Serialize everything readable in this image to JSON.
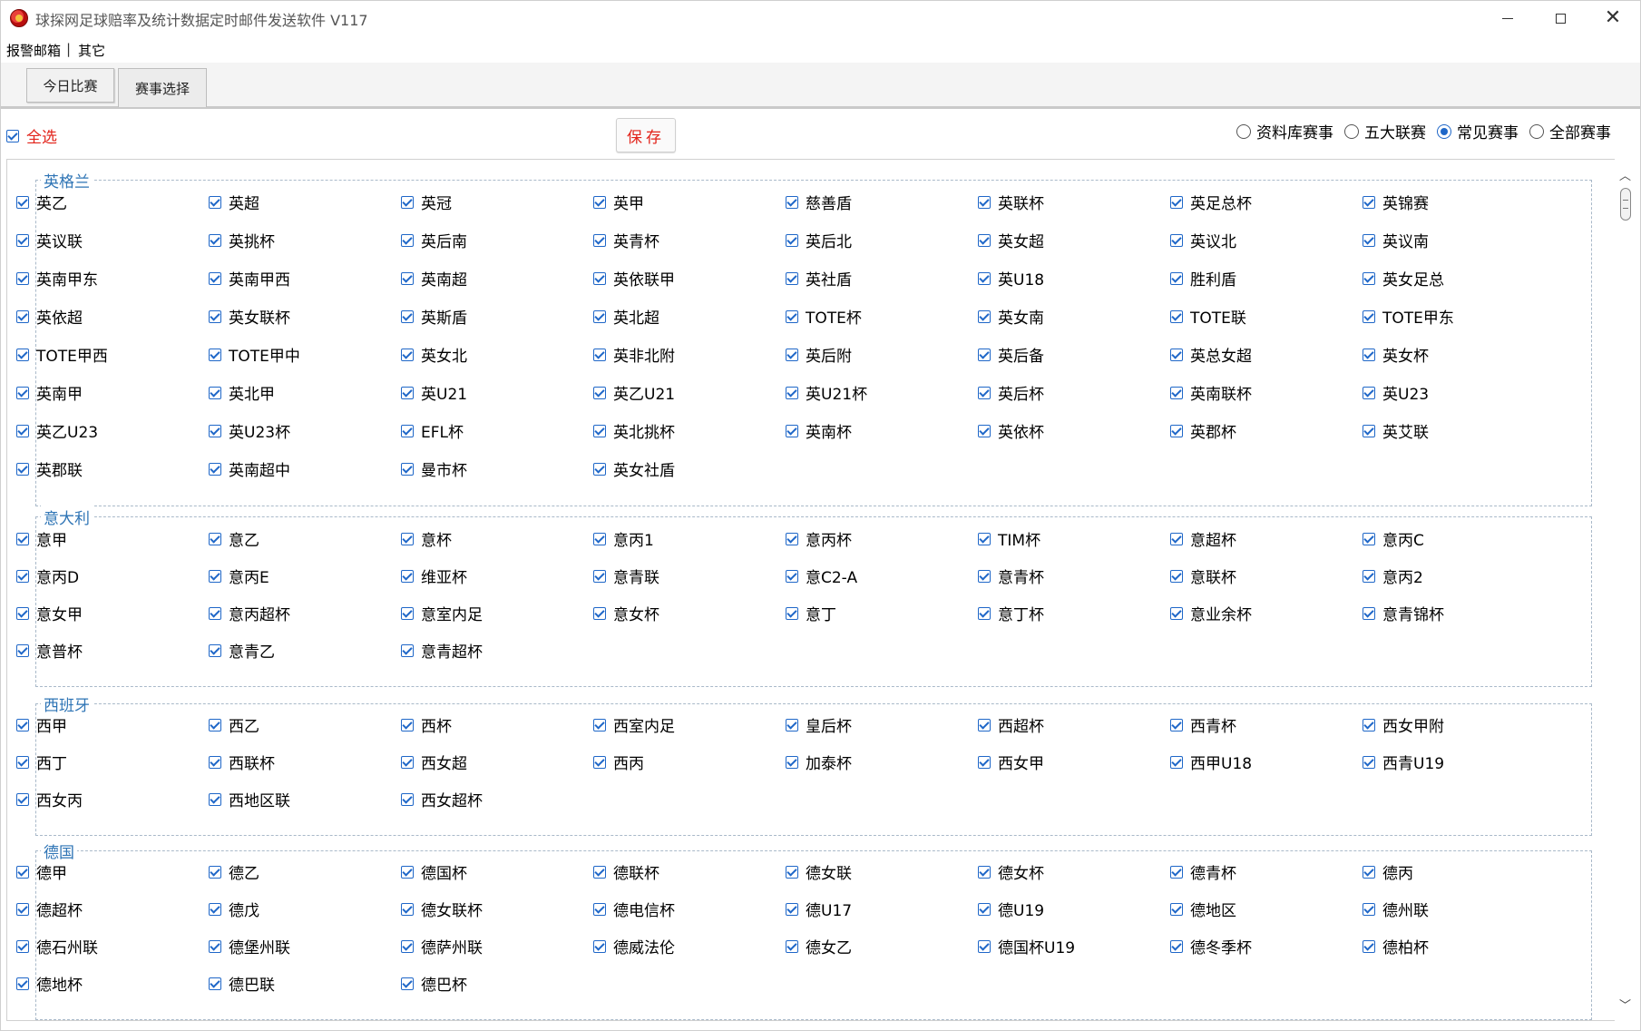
{
  "window": {
    "title": "球探网足球赔率及统计数据定时邮件发送软件 V117"
  },
  "menu": {
    "items": [
      "报警邮箱",
      "|",
      "其它"
    ]
  },
  "tabs": [
    {
      "label": "今日比赛",
      "active": false
    },
    {
      "label": "赛事选择",
      "active": true
    }
  ],
  "toolbar": {
    "select_all_label": "全选",
    "select_all_checked": true,
    "save_label": "保存"
  },
  "filters": [
    {
      "label": "资料库赛事",
      "selected": false
    },
    {
      "label": "五大联赛",
      "selected": false
    },
    {
      "label": "常见赛事",
      "selected": true
    },
    {
      "label": "全部赛事",
      "selected": false
    }
  ],
  "groups": [
    {
      "name": "英格兰",
      "items": [
        "英乙",
        "英超",
        "英冠",
        "英甲",
        "慈善盾",
        "英联杯",
        "英足总杯",
        "英锦赛",
        "英议联",
        "英挑杯",
        "英后南",
        "英青杯",
        "英后北",
        "英女超",
        "英议北",
        "英议南",
        "英南甲东",
        "英南甲西",
        "英南超",
        "英依联甲",
        "英社盾",
        "英U18",
        "胜利盾",
        "英女足总",
        "英依超",
        "英女联杯",
        "英斯盾",
        "英北超",
        "TOTE杯",
        "英女南",
        "TOTE联",
        "TOTE甲东",
        "TOTE甲西",
        "TOTE甲中",
        "英女北",
        "英非北附",
        "英后附",
        "英后备",
        "英总女超",
        "英女杯",
        "英南甲",
        "英北甲",
        "英U21",
        "英乙U21",
        "英U21杯",
        "英后杯",
        "英南联杯",
        "英U23",
        "英乙U23",
        "英U23杯",
        "EFL杯",
        "英北挑杯",
        "英南杯",
        "英依杯",
        "英郡杯",
        "英艾联",
        "英郡联",
        "英南超中",
        "曼市杯",
        "英女社盾"
      ]
    },
    {
      "name": "意大利",
      "items": [
        "意甲",
        "意乙",
        "意杯",
        "意丙1",
        "意丙杯",
        "TIM杯",
        "意超杯",
        "意丙C",
        "意丙D",
        "意丙E",
        "维亚杯",
        "意青联",
        "意C2-A",
        "意青杯",
        "意联杯",
        "意丙2",
        "意女甲",
        "意丙超杯",
        "意室内足",
        "意女杯",
        "意丁",
        "意丁杯",
        "意业余杯",
        "意青锦杯",
        "意普杯",
        "意青乙",
        "意青超杯"
      ]
    },
    {
      "name": "西班牙",
      "items": [
        "西甲",
        "西乙",
        "西杯",
        "西室内足",
        "皇后杯",
        "西超杯",
        "西青杯",
        "西女甲附",
        "西丁",
        "西联杯",
        "西女超",
        "西丙",
        "加泰杯",
        "西女甲",
        "西甲U18",
        "西青U19",
        "西女丙",
        "西地区联",
        "西女超杯"
      ]
    },
    {
      "name": "德国",
      "items": [
        "德甲",
        "德乙",
        "德国杯",
        "德联杯",
        "德女联",
        "德女杯",
        "德青杯",
        "德丙",
        "德超杯",
        "德戊",
        "德女联杯",
        "德电信杯",
        "德U17",
        "德U19",
        "德地区",
        "德州联",
        "德石州联",
        "德堡州联",
        "德萨州联",
        "德威法伦",
        "德女乙",
        "德国杯U19",
        "德冬季杯",
        "德柏杯",
        "德地杯",
        "德巴联",
        "德巴杯"
      ]
    }
  ]
}
